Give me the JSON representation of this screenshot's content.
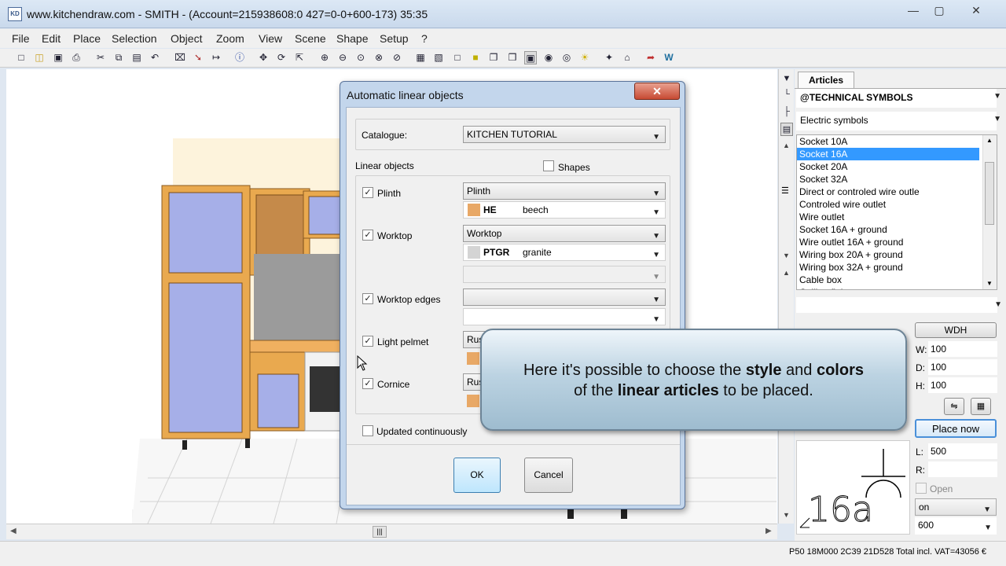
{
  "window": {
    "title": "www.kitchendraw.com - SMITH - (Account=215938608:0 427=0-0+600-173) 35:35",
    "icon": "KD"
  },
  "menu": [
    "File",
    "Edit",
    "Place",
    "Selection",
    "Object",
    "Zoom",
    "View",
    "Scene",
    "Shape",
    "Setup",
    "?"
  ],
  "dialog": {
    "title": "Automatic linear objects",
    "catalogue_label": "Catalogue:",
    "catalogue_value": "KITCHEN TUTORIAL",
    "linear_objects_label": "Linear objects",
    "shapes_label": "Shapes",
    "rows": [
      {
        "label": "Plinth",
        "checked": true,
        "style": "Plinth",
        "code": "HE",
        "finish": "beech",
        "color": "#e8a866"
      },
      {
        "label": "Worktop",
        "checked": true,
        "style": "Worktop",
        "code": "PTGR",
        "finish": "granite",
        "color": "#d4d4d4"
      },
      {
        "label": "Worktop edges",
        "checked": true,
        "style": "",
        "code": "",
        "finish": "",
        "color": ""
      },
      {
        "label": "Light pelmet",
        "checked": true,
        "style": "Rus",
        "code": "",
        "finish": "",
        "color": "#e8a866"
      },
      {
        "label": "Cornice",
        "checked": true,
        "style": "Rus",
        "code": "",
        "finish": "",
        "color": "#e8a866"
      }
    ],
    "updated_label": "Updated continuously",
    "ok": "OK",
    "cancel": "Cancel"
  },
  "callout": {
    "pre": "Here it's possible to choose the ",
    "b1": "style",
    "mid": " and ",
    "b2": "colors",
    "line2pre": "of the ",
    "b3": "linear articles",
    "line2post": " to be placed."
  },
  "panel": {
    "tab": "Articles",
    "catalog": "@TECHNICAL SYMBOLS",
    "family": "Electric symbols",
    "items": [
      "Socket 10A",
      "Socket 16A",
      "Socket 20A",
      "Socket 32A",
      "Direct or controled wire outle",
      "Controled wire outlet",
      "Wire outlet",
      "Socket 16A + ground",
      "Wire outlet 16A + ground",
      "Wiring box 20A + ground",
      "Wiring box 32A + ground",
      "Cable box",
      "Ceiling fitting"
    ],
    "selected_index": 1,
    "wdh": "WDH",
    "w_label": "W:",
    "w": "100",
    "d_label": "D:",
    "d": "100",
    "h_label": "H:",
    "h": "100",
    "place_now": "Place now",
    "l_label": "L:",
    "l": "500",
    "r_label": "R:",
    "r": "",
    "open_label": "Open",
    "on_value": "on",
    "size_value": "600",
    "symbol_text": "16a"
  },
  "status": "P50 18M000 2C39 21D528 Total incl. VAT=43056 €"
}
